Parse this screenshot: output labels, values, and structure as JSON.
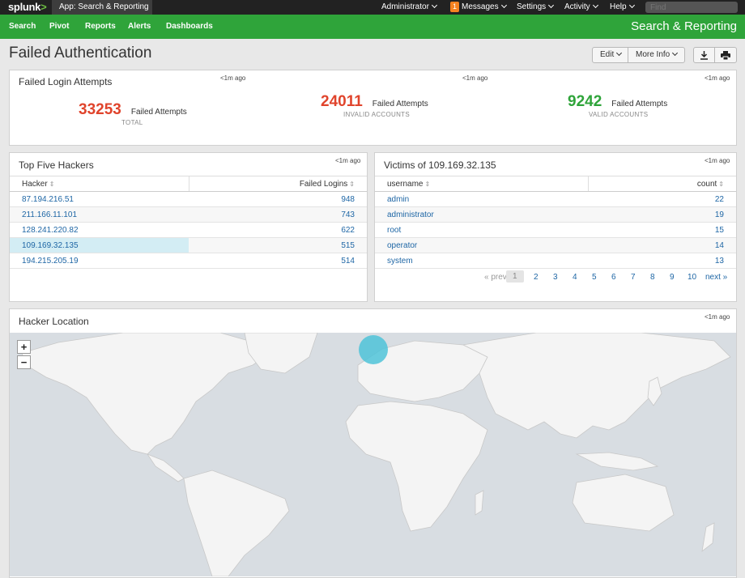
{
  "topbar": {
    "logo": "splunk",
    "logo_mark": ">",
    "app_menu": "App: Search & Reporting",
    "user": "Administrator",
    "messages_count": "1",
    "messages": "Messages",
    "settings": "Settings",
    "activity": "Activity",
    "help": "Help",
    "find_placeholder": "Find"
  },
  "appbar": {
    "nav": [
      "Search",
      "Pivot",
      "Reports",
      "Alerts",
      "Dashboards"
    ],
    "title": "Search & Reporting"
  },
  "page": {
    "title": "Failed Authentication",
    "edit": "Edit",
    "more_info": "More Info"
  },
  "failed_logins": {
    "title": "Failed Login Attempts",
    "singles": [
      {
        "value": "33253",
        "unit": "Failed Attempts",
        "under": "TOTAL",
        "ago": "<1m ago",
        "color": "#e0442c"
      },
      {
        "value": "24011",
        "unit": "Failed Attempts",
        "under": "INVALID ACCOUNTS",
        "ago": "<1m ago",
        "color": "#e0442c"
      },
      {
        "value": "9242",
        "unit": "Failed Attempts",
        "under": "VALID ACCOUNTS",
        "ago": "<1m ago",
        "color": "#2fa43a"
      }
    ]
  },
  "hackers": {
    "title": "Top Five Hackers",
    "ago": "<1m ago",
    "columns": [
      "Hacker",
      "Failed Logins"
    ],
    "rows": [
      [
        "87.194.216.51",
        "948"
      ],
      [
        "211.166.11.101",
        "743"
      ],
      [
        "128.241.220.82",
        "622"
      ],
      [
        "109.169.32.135",
        "515"
      ],
      [
        "194.215.205.19",
        "514"
      ]
    ]
  },
  "victims": {
    "title": "Victims of 109.169.32.135",
    "ago": "<1m ago",
    "columns": [
      "username",
      "count"
    ],
    "rows": [
      [
        "admin",
        "22"
      ],
      [
        "administrator",
        "19"
      ],
      [
        "root",
        "15"
      ],
      [
        "operator",
        "14"
      ],
      [
        "system",
        "13"
      ]
    ],
    "pager": {
      "prev": "« prev",
      "pages": [
        "1",
        "2",
        "3",
        "4",
        "5",
        "6",
        "7",
        "8",
        "9",
        "10"
      ],
      "next": "next »"
    }
  },
  "location": {
    "title": "Hacker Location",
    "ago": "<1m ago",
    "zoom_in": "+",
    "zoom_out": "−",
    "marker_color": "#4fc3d8"
  }
}
